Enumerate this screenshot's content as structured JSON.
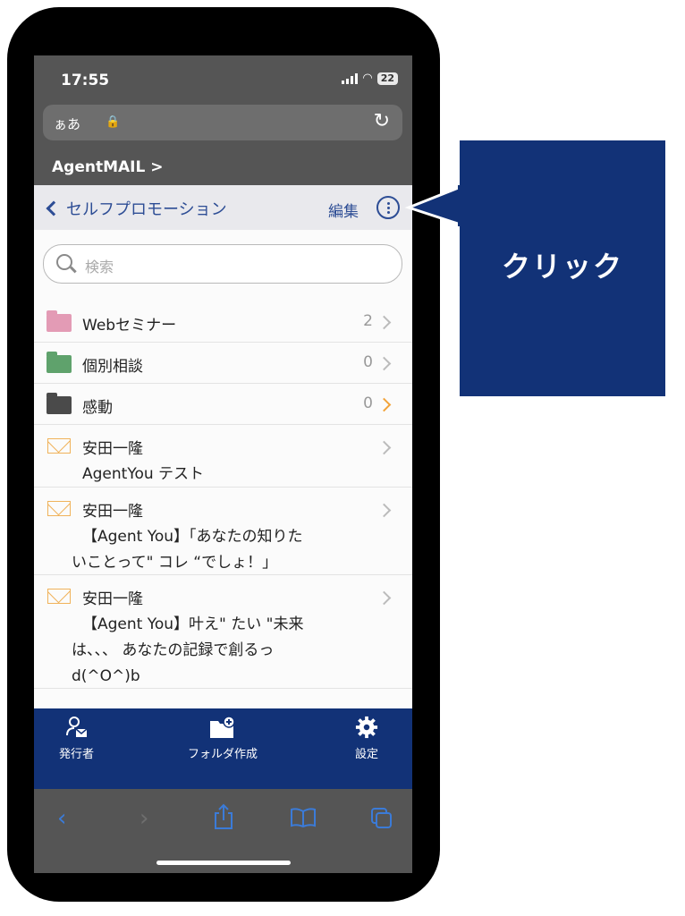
{
  "status_bar": {
    "time": "17:55",
    "battery": "22"
  },
  "browser": {
    "text_size_label": "ぁあ"
  },
  "site": {
    "title": "AgentMAIL >"
  },
  "nav": {
    "back_label": "セルフプロモーション",
    "edit_label": "編集"
  },
  "search": {
    "placeholder": "検索"
  },
  "folders": [
    {
      "name": "Webセミナー",
      "count": "2",
      "color": "#e39bb5"
    },
    {
      "name": "個別相談",
      "count": "0",
      "color": "#5fa26c"
    },
    {
      "name": "感動",
      "count": "0",
      "color": "#4a4a4a"
    }
  ],
  "mails": [
    {
      "sender": "安田一隆",
      "lines": [
        "AgentYou テスト"
      ]
    },
    {
      "sender": "安田一隆",
      "lines": [
        "【Agent You】「あなたの知りた",
        "いことって\" コレ “でしょ！」"
      ]
    },
    {
      "sender": "安田一隆",
      "lines": [
        "【Agent You】叶え\" たい \"未来",
        "は、、、 あなたの記録で創るっ",
        "d(^O^)b"
      ]
    }
  ],
  "tabs": [
    {
      "label": "発行者",
      "icon": "user-mail-icon"
    },
    {
      "label": "フォルダ作成",
      "icon": "folder-add-icon"
    },
    {
      "label": "設定",
      "icon": "gear-icon"
    }
  ],
  "callout": {
    "text": "クリック",
    "color": "#123277"
  }
}
